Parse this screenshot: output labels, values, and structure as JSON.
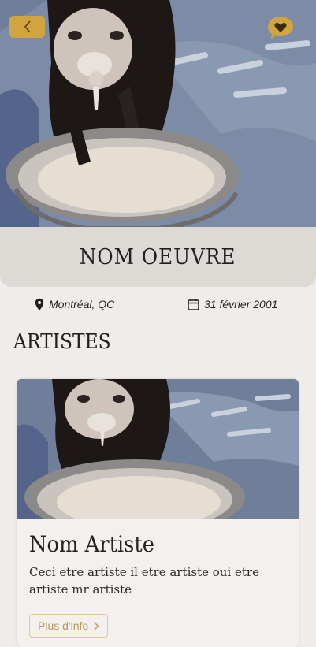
{
  "hero": {
    "image_alt": "Chaton buvant du lait"
  },
  "header": {
    "back_icon": "chevron-left-icon",
    "favorite_icon": "heart-bubble-icon",
    "accent_color": "#d2a441"
  },
  "artwork": {
    "title": "NOM OEUVRE",
    "location": "Montréal, QC",
    "date": "31 février 2001",
    "location_icon": "map-pin-icon",
    "date_icon": "calendar-icon"
  },
  "artists_section": {
    "heading": "ARTISTES",
    "cards": [
      {
        "name": "Nom Artiste",
        "description": "Ceci etre artiste il etre artiste oui etre artiste mr artiste",
        "button_label": "Plus d'info"
      }
    ]
  }
}
